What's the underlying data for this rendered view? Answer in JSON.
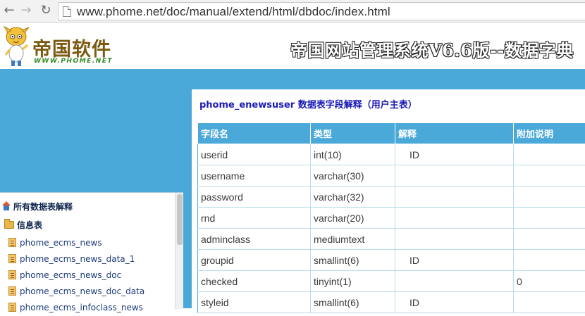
{
  "browser": {
    "url": "www.phome.net/doc/manual/extend/html/dbdoc/index.html",
    "back_icon": "arrow-left-icon",
    "forward_icon": "arrow-right-icon",
    "reload_icon": "reload-icon"
  },
  "header": {
    "logo_text": "帝国软件",
    "logo_sub": "WWW.PHOME.NET",
    "site_title": "帝国网站管理系统V6.6版--数据字典"
  },
  "sidebar": {
    "root_label": "所有数据表解释",
    "folder_label": "信息表",
    "items": [
      {
        "label": "phome_ecms_news"
      },
      {
        "label": "phome_ecms_news_data_1"
      },
      {
        "label": "phome_ecms_news_doc"
      },
      {
        "label": "phome_ecms_news_doc_data"
      },
      {
        "label": "phome_ecms_infoclass_news"
      }
    ]
  },
  "main": {
    "table_title": "phome_enewsuser 数据表字段解释（用户主表）",
    "headers": [
      "字段名",
      "类型",
      "解释",
      "附加说明"
    ],
    "rows": [
      {
        "field": "userid",
        "type": "int(10)",
        "desc": "ID",
        "note": ""
      },
      {
        "field": "username",
        "type": "varchar(30)",
        "desc": "",
        "note": ""
      },
      {
        "field": "password",
        "type": "varchar(32)",
        "desc": "",
        "note": ""
      },
      {
        "field": "rnd",
        "type": "varchar(20)",
        "desc": "",
        "note": ""
      },
      {
        "field": "adminclass",
        "type": "mediumtext",
        "desc": "",
        "note": ""
      },
      {
        "field": "groupid",
        "type": "smallint(6)",
        "desc": "ID",
        "note": ""
      },
      {
        "field": "checked",
        "type": "tinyint(1)",
        "desc": "",
        "note": "0"
      },
      {
        "field": "styleid",
        "type": "smallint(6)",
        "desc": "ID",
        "note": ""
      }
    ]
  },
  "colors": {
    "accent_blue": "#4aa9d9",
    "title_blue": "#1a1ab8",
    "logo_brown": "#7a5a10",
    "logo_green": "#2f8a22"
  }
}
